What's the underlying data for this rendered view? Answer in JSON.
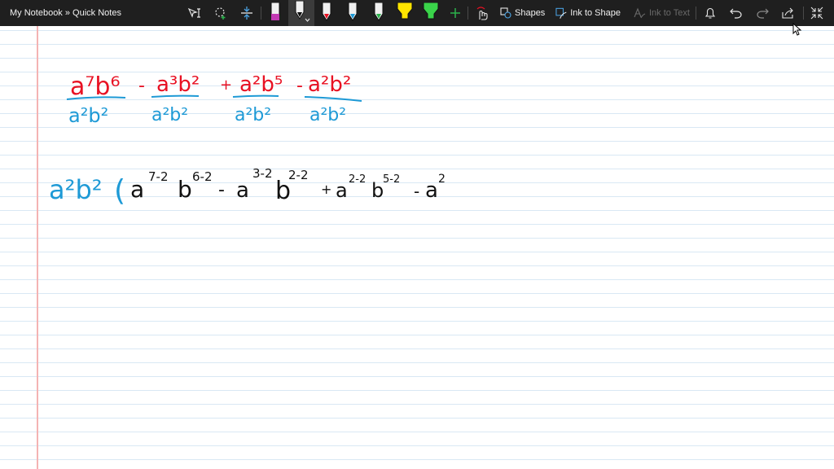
{
  "toolbar": {
    "breadcrumb": "My Notebook » Quick Notes",
    "shapes_label": "Shapes",
    "ink_to_shape_label": "Ink to Shape",
    "ink_to_text_label": "Ink to Text",
    "colors": {
      "bg": "#1f1f1f",
      "pen_black": "#111111",
      "pen_red": "#e81123",
      "pen_blue": "#1e9ad6",
      "pen_green": "#2bb24c",
      "highlighter_yellow": "#ffe500",
      "highlighter_green": "#3ad34a",
      "marker_magenta": "#c239b3"
    },
    "icons": [
      "lasso-select-icon",
      "lasso-add-icon",
      "insert-space-icon",
      "highlighter-magenta-icon",
      "pen-black-icon",
      "pen-red-icon",
      "pen-blue-icon",
      "pen-green-icon",
      "highlighter-yellow-icon",
      "highlighter-green-icon",
      "add-pen-icon",
      "touch-draw-icon",
      "shapes-icon",
      "ink-to-shape-icon",
      "ink-to-text-icon",
      "bell-icon",
      "undo-icon",
      "redo-icon",
      "share-icon",
      "collapse-icon"
    ]
  },
  "canvas": {
    "ink_colors": {
      "red": "#e81123",
      "blue": "#1e9ad6",
      "black": "#111111"
    },
    "line1": {
      "num1": "a⁷b⁶",
      "den1": "a²b²",
      "op1": "-",
      "num2": "a³b²",
      "den2": "a²b²",
      "op2": "+",
      "num3": "a²b⁵",
      "den3": "a²b²",
      "op3": "-",
      "num4": "a²b²",
      "den4": "a²b²"
    },
    "line2": {
      "factor": "a²b²",
      "paren": "(",
      "t1_base_a": "a",
      "t1_exp_a": "7-2",
      "t1_base_b": "b",
      "t1_exp_b": "6-2",
      "op1": "-",
      "t2_base_a": "a",
      "t2_exp_a": "3-2",
      "t2_base_b": "b",
      "t2_exp_b": "2-2",
      "op2": "+",
      "t3_base_a": "a",
      "t3_exp_a": "2-2",
      "t3_base_b": "b",
      "t3_exp_b": "5-2",
      "op3": "-",
      "t4_base_a": "a",
      "t4_exp_a": "2"
    }
  }
}
